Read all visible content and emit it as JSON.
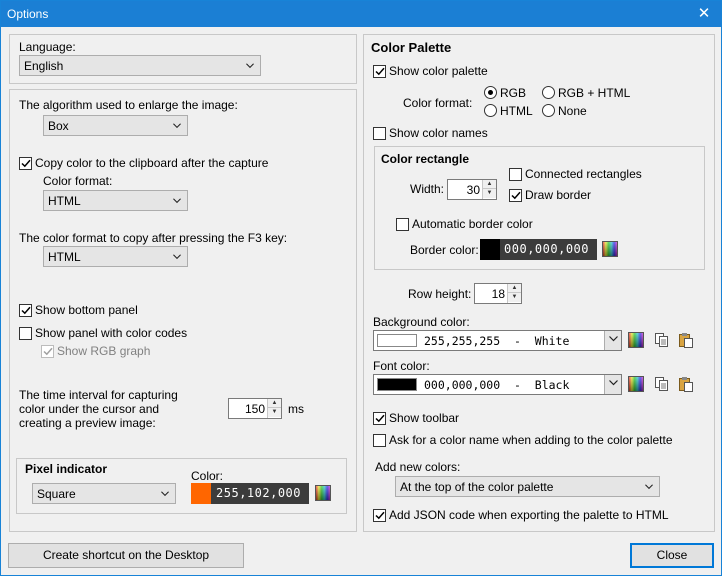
{
  "window": {
    "title": "Options"
  },
  "left": {
    "language": {
      "label": "Language:",
      "value": "English"
    },
    "algorithm": {
      "label": "The algorithm used to enlarge the image:",
      "value": "Box"
    },
    "copy_clipboard": {
      "label": "Copy color to the clipboard after the capture",
      "checked": true
    },
    "color_format": {
      "label": "Color format:",
      "value": "HTML"
    },
    "f3_format": {
      "label": "The color format to copy after pressing the F3 key:",
      "value": "HTML"
    },
    "show_bottom_panel": {
      "label": "Show bottom panel",
      "checked": true
    },
    "show_color_codes": {
      "label": "Show panel with color codes",
      "checked": false
    },
    "show_rgb_graph": {
      "label": "Show RGB graph",
      "checked": true,
      "disabled": true
    },
    "interval": {
      "line1": "The time interval for capturing",
      "line2": "color under the cursor and",
      "line3": "creating a preview image:",
      "value": "150",
      "unit": "ms"
    },
    "pixel_indicator": {
      "title": "Pixel indicator",
      "shape": "Square",
      "color_label": "Color:",
      "color_value": "255,102,000",
      "color_hex": "#ff6600"
    }
  },
  "right": {
    "title": "Color Palette",
    "show_palette": {
      "label": "Show color palette",
      "checked": true
    },
    "color_format": {
      "label": "Color format:",
      "options": [
        {
          "label": "RGB",
          "selected": true
        },
        {
          "label": "RGB + HTML",
          "selected": false
        },
        {
          "label": "HTML",
          "selected": false
        },
        {
          "label": "None",
          "selected": false
        }
      ]
    },
    "show_names": {
      "label": "Show color names",
      "checked": false
    },
    "rect": {
      "title": "Color rectangle",
      "width_label": "Width:",
      "width_value": "30",
      "connected": {
        "label": "Connected rectangles",
        "checked": false
      },
      "draw_border": {
        "label": "Draw border",
        "checked": true
      },
      "auto_border": {
        "label": "Automatic border color",
        "checked": false
      },
      "border_label": "Border color:",
      "border_value": "000,000,000",
      "border_hex": "#000000"
    },
    "row_height": {
      "label": "Row height:",
      "value": "18"
    },
    "background": {
      "label": "Background color:",
      "value": "255,255,255  -  White",
      "hex": "#ffffff"
    },
    "font": {
      "label": "Font color:",
      "value": "000,000,000  -  Black",
      "hex": "#000000"
    },
    "show_toolbar": {
      "label": "Show toolbar",
      "checked": true
    },
    "ask_name": {
      "label": "Ask for a color name when adding to the color palette",
      "checked": false
    },
    "add_new": {
      "label": "Add new colors:",
      "value": "At the top of the color palette"
    },
    "json_export": {
      "label": "Add JSON code when exporting the palette to HTML",
      "checked": true
    }
  },
  "buttons": {
    "shortcut": "Create shortcut on the Desktop",
    "close": "Close"
  },
  "colors": {
    "accent": "#0078d7",
    "titlebar": "#1b7fd4"
  }
}
